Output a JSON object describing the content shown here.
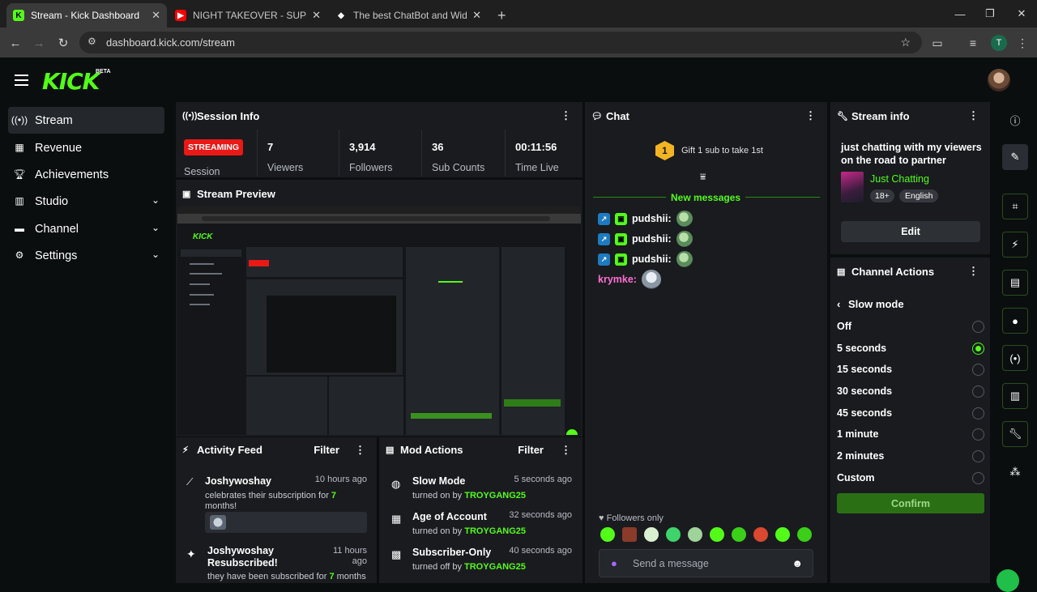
{
  "browser": {
    "tabs": [
      {
        "title": "Stream - Kick Dashboard",
        "favicon": "kick-icon"
      },
      {
        "title": "NIGHT TAKEOVER - SUPERBIKE",
        "favicon": "youtube-icon"
      },
      {
        "title": "The best ChatBot and Widgets",
        "favicon": "diamond-icon"
      }
    ],
    "new_tab": "+",
    "url": "dashboard.kick.com/stream",
    "profile_initial": "T"
  },
  "app": {
    "logo": "KICK",
    "logo_badge": "BETA",
    "accent": "#53fc18",
    "sidebar": [
      {
        "label": "Stream",
        "icon": "broadcast-icon"
      },
      {
        "label": "Revenue",
        "icon": "chart-icon"
      },
      {
        "label": "Achievements",
        "icon": "trophy-icon"
      },
      {
        "label": "Studio",
        "icon": "layout-icon"
      },
      {
        "label": "Channel",
        "icon": "channel-icon"
      },
      {
        "label": "Settings",
        "icon": "gear-icon"
      }
    ]
  },
  "session": {
    "title": "Session Info",
    "status": "STREAMING",
    "status_label": "Session",
    "stats": [
      {
        "value": "7",
        "label": "Viewers"
      },
      {
        "value": "3,914",
        "label": "Followers"
      },
      {
        "value": "36",
        "label": "Sub Counts"
      },
      {
        "value": "00:11:56",
        "label": "Time Live"
      }
    ]
  },
  "preview": {
    "title": "Stream Preview"
  },
  "activity": {
    "title": "Activity Feed",
    "filter": "Filter",
    "items": [
      {
        "user": "Joshywoshay",
        "pre": "celebrates their subscription for ",
        "hl": "7",
        "post": " months!",
        "ago": "10 hours ago"
      },
      {
        "user": "Joshywoshay Resubscribed!",
        "pre": "they have been subscribed for ",
        "hl": "7",
        "post": " months",
        "ago": "11 hours ago"
      }
    ]
  },
  "mod": {
    "title": "Mod Actions",
    "filter": "Filter",
    "items": [
      {
        "action": "Slow Mode",
        "pre": "turned on by ",
        "by": "TROYGANG25",
        "ago": "5 seconds ago"
      },
      {
        "action": "Age of Account",
        "pre": "turned on by ",
        "by": "TROYGANG25",
        "ago": "32 seconds ago"
      },
      {
        "action": "Subscriber-Only",
        "pre": "turned off by ",
        "by": "TROYGANG25",
        "ago": "40 seconds ago"
      }
    ]
  },
  "chat": {
    "title": "Chat",
    "gift_badge": "1",
    "gift_text": "Gift 1 sub to take 1st",
    "new_messages": "New messages",
    "messages": [
      {
        "user": "pudshii:"
      },
      {
        "user": "pudshii:"
      },
      {
        "user": "pudshii:"
      },
      {
        "user": "krymke:"
      }
    ],
    "followers_only": "Followers only",
    "placeholder": "Send a message"
  },
  "stream_info": {
    "title": "Stream info",
    "stream_title": "just chatting with my viewers on the road to partner",
    "category": "Just Chatting",
    "tags": [
      "18+",
      "English"
    ],
    "edit": "Edit"
  },
  "channel_actions": {
    "title": "Channel Actions",
    "section": "Slow mode",
    "options": [
      "Off",
      "5 seconds",
      "15 seconds",
      "30 seconds",
      "45 seconds",
      "1 minute",
      "2 minutes",
      "Custom"
    ],
    "selected": "5 seconds",
    "confirm": "Confirm"
  }
}
